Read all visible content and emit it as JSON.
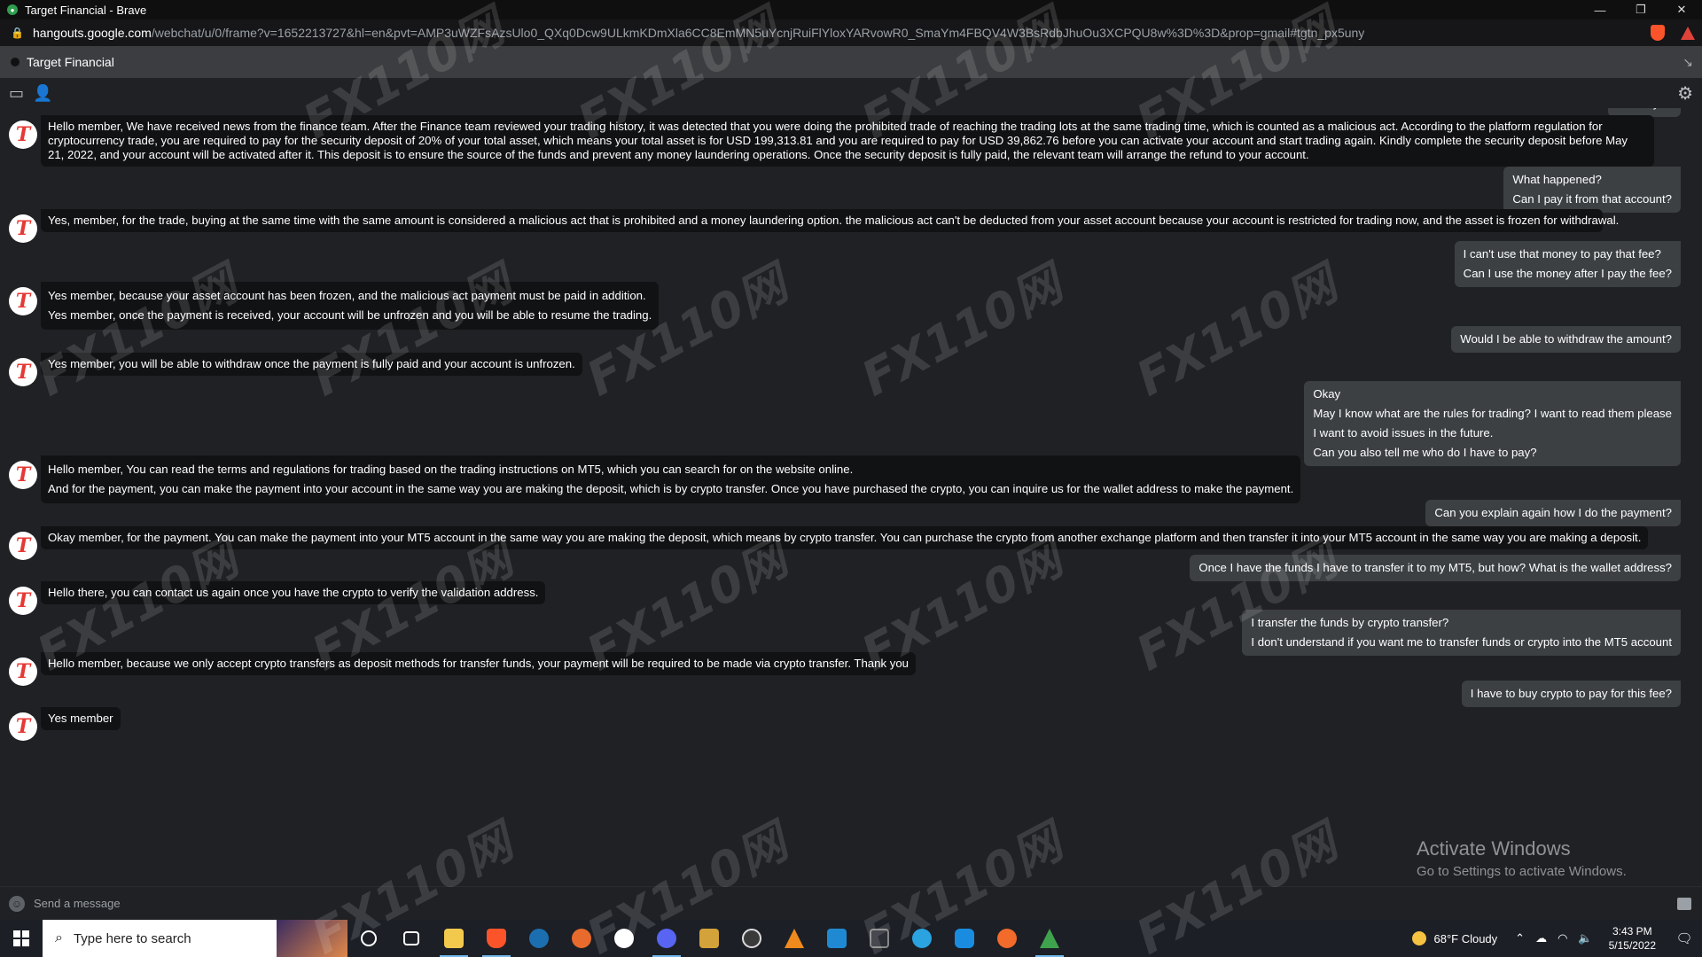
{
  "window": {
    "title": "Target Financial - Brave",
    "minimize": "—",
    "restore": "❐",
    "close": "✕"
  },
  "address": {
    "host": "hangouts.google.com",
    "rest": "/webchat/u/0/frame?v=1652213727&hl=en&pvt=AMP3uWZFsAzsUlo0_QXq0Dcw9ULkmKDmXla6CC8EmMN5uYcnjRuiFlYloxYARvowR0_SmaYm4FBQV4W3BsRdbJhuOu3XCPQU8w%3D%3D&prop=gmail#tgtn_px5uny"
  },
  "chat": {
    "name": "Target Financial",
    "input_placeholder": "Send a message"
  },
  "messages": [
    {
      "side": "out",
      "lines": [
        "Thank you"
      ]
    },
    {
      "side": "in",
      "lines": [
        "Hello member, We have received news from the finance team. After the Finance team reviewed your trading history, it was detected that you were doing the prohibited trade of reaching the trading lots at the same trading time, which is counted as a malicious act. According to the platform regulation for cryptocurrency trade, you are required to pay for the security deposit of 20% of your total asset, which means your total asset is for USD 199,313.81 and you are required to pay for USD 39,862.76 before you can activate your account and start trading again. Kindly complete the security deposit before May 21, 2022, and your account will be activated after it. This deposit is to ensure the source of the funds and prevent any money laundering operations. Once the security deposit is fully paid, the relevant team will arrange the refund to your account."
      ]
    },
    {
      "side": "out",
      "lines": [
        "What happened?",
        "Can I pay it from that account?"
      ]
    },
    {
      "side": "in",
      "lines": [
        "Yes, member, for the trade, buying at the same time with the same amount is considered a malicious act that is prohibited and a money laundering option. the malicious act can't be deducted from your asset account because your account is restricted for trading now, and the asset is frozen for withdrawal."
      ]
    },
    {
      "side": "out",
      "lines": [
        "I can't use that money to pay that fee?",
        "Can I use the money after I pay the fee?"
      ]
    },
    {
      "side": "in",
      "lines": [
        "Yes member, because your asset account has been frozen, and the malicious act payment must be paid in addition.",
        "Yes member, once the payment is received, your account will be unfrozen and you will be able to resume the trading."
      ]
    },
    {
      "side": "out",
      "lines": [
        "Would I be able to withdraw the amount?"
      ]
    },
    {
      "side": "in",
      "lines": [
        "Yes member, you will be able to withdraw once the payment is fully paid and your account is unfrozen."
      ]
    },
    {
      "side": "out",
      "lines": [
        "Okay",
        "May I know what are the rules for trading? I want to read them please",
        "I want to avoid issues in the future.",
        "Can you also tell me who do I have to pay?"
      ]
    },
    {
      "side": "in",
      "lines": [
        "Hello member, You can read the terms and regulations for trading based on the trading instructions on MT5, which you can search for on the website online.",
        "And for the payment, you can make the payment into your account in the same way you are making the deposit, which is by crypto transfer. Once you have purchased the crypto, you can inquire us for the wallet address to make the payment."
      ]
    },
    {
      "side": "out",
      "lines": [
        "Can you explain again how I do the payment?"
      ]
    },
    {
      "side": "in",
      "lines": [
        "Okay member, for the payment. You can make the payment into your MT5 account in the same way you are making the deposit, which means by crypto transfer. You can purchase the crypto from another exchange platform and then transfer it into your MT5 account in the same way you are making a deposit."
      ]
    },
    {
      "side": "out",
      "lines": [
        "Once I have the funds I have to transfer it to my MT5, but how? What is the wallet address?"
      ]
    },
    {
      "side": "in",
      "lines": [
        "Hello there, you can contact us again once you have the crypto to verify the validation address."
      ]
    },
    {
      "side": "out",
      "lines": [
        "I transfer the funds by crypto transfer?",
        "I don't understand if you want me to transfer funds or crypto into the MT5 account"
      ]
    },
    {
      "side": "in",
      "lines": [
        "Hello member, because we only accept crypto transfers as deposit methods for transfer funds, your payment will be required to be made via crypto transfer. Thank you"
      ]
    },
    {
      "side": "out",
      "lines": [
        "I have to buy crypto to pay for this fee?"
      ]
    },
    {
      "side": "in",
      "lines": [
        "Yes member"
      ]
    }
  ],
  "activation": {
    "title": "Activate Windows",
    "subtitle": "Go to Settings to activate Windows."
  },
  "watermark": "FX110网",
  "taskbar": {
    "search_placeholder": "Type here to search",
    "weather": "68°F  Cloudy",
    "time": "3:43 PM",
    "date": "5/15/2022"
  }
}
